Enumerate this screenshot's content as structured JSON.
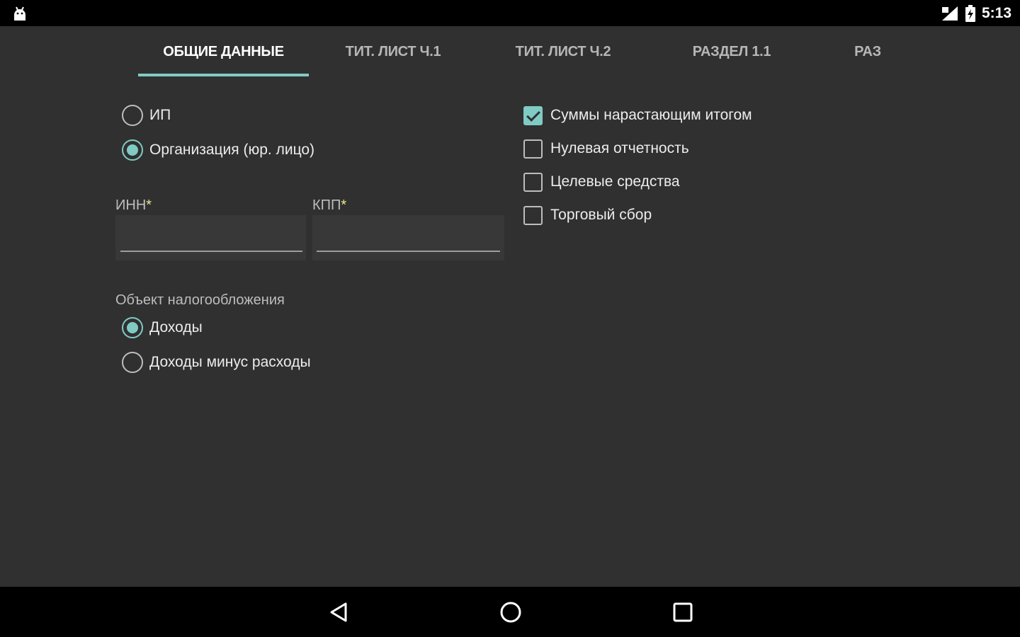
{
  "status_bar": {
    "time": "5:13"
  },
  "tabs": [
    {
      "label": "ОБЩИЕ ДАННЫЕ",
      "active": true
    },
    {
      "label": "ТИТ. ЛИСТ Ч.1",
      "active": false
    },
    {
      "label": "ТИТ. ЛИСТ Ч.2",
      "active": false
    },
    {
      "label": "РАЗДЕЛ 1.1",
      "active": false
    },
    {
      "label": "РАЗ",
      "active": false
    }
  ],
  "taxpayer_type": {
    "options": [
      {
        "label": "ИП",
        "checked": false
      },
      {
        "label": "Организация (юр. лицо)",
        "checked": true
      }
    ]
  },
  "fields": {
    "inn": {
      "label": "ИНН",
      "required_mark": "*",
      "value": ""
    },
    "kpp": {
      "label": "КПП",
      "required_mark": "*",
      "value": ""
    }
  },
  "tax_object": {
    "label": "Объект налогообложения",
    "options": [
      {
        "label": "Доходы",
        "checked": true
      },
      {
        "label": "Доходы минус расходы",
        "checked": false
      }
    ]
  },
  "flags": [
    {
      "label": "Суммы нарастающим итогом",
      "checked": true
    },
    {
      "label": "Нулевая отчетность",
      "checked": false
    },
    {
      "label": "Целевые средства",
      "checked": false
    },
    {
      "label": "Торговый сбор",
      "checked": false
    }
  ],
  "colors": {
    "accent": "#80cbc4",
    "background": "#303030",
    "bars": "#000000"
  }
}
